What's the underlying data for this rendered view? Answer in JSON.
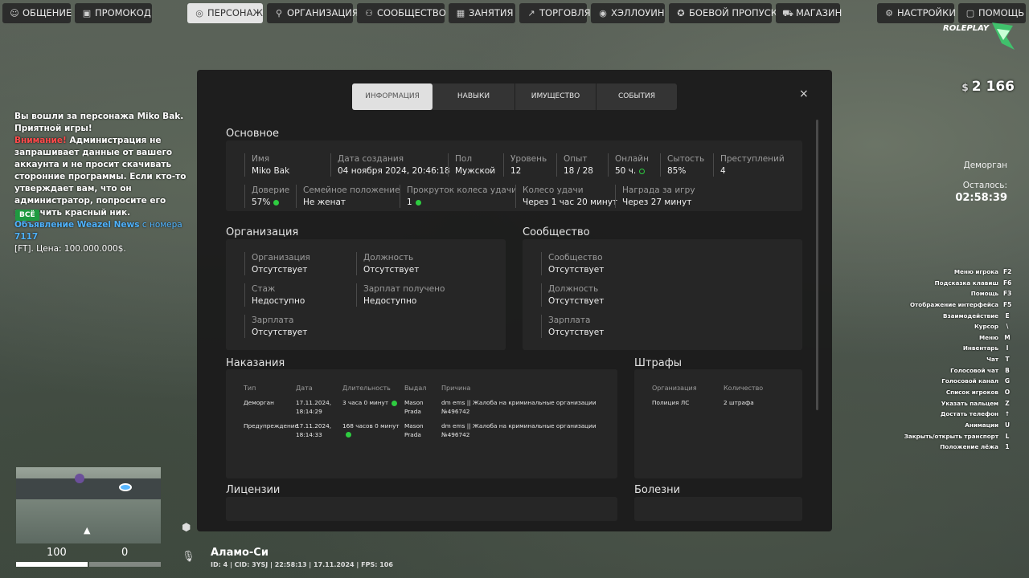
{
  "nav": [
    {
      "label": "ОБЩЕНИЕ",
      "icon": "chat-bubble-icon"
    },
    {
      "label": "ПРОМОКОД",
      "icon": "ticket-icon"
    },
    {
      "label": "ПЕРСОНАЖ",
      "icon": "person-icon",
      "active": true
    },
    {
      "label": "ОРГАНИЗАЦИЯ",
      "icon": "organization-icon"
    },
    {
      "label": "СООБЩЕСТВО",
      "icon": "community-icon"
    },
    {
      "label": "ЗАНЯТИЯ",
      "icon": "calendar-icon"
    },
    {
      "label": "ТОРГОВЛЯ",
      "icon": "trade-chart-icon"
    },
    {
      "label": "ХЭЛЛОУИН",
      "icon": "pumpkin-icon"
    },
    {
      "label": "БОЕВОЙ ПРОПУСК",
      "icon": "battlepass-icon"
    },
    {
      "label": "МАГАЗИН",
      "icon": "cart-icon"
    },
    {
      "label": "НАСТРОЙКИ",
      "icon": "settings-icon"
    },
    {
      "label": "ПОМОЩЬ",
      "icon": "help-icon"
    }
  ],
  "chat": {
    "line1": "Вы вошли за персонажа Miko Bak. Приятной игры!",
    "warn_prefix": "Внимание!",
    "warn_text": " Администрация не запрашивает данные от вашего аккаунта и не просит скачивать сторонние программы. Если кто-то утверждает вам, что он администратор, попросите его включить красный ник.",
    "news_prefix": "Объявление Weazel News",
    "news_from": " с номера ",
    "news_number": "7117",
    "news_text": "[FT]. Цена: 100.000.000$.",
    "all_button": "ВСЁ"
  },
  "hud": {
    "currency": "$",
    "money": "2 166",
    "logo_text": "ROLEPLAY",
    "status": "Деморган",
    "remain_label": "Осталось:",
    "remain_value": "02:58:39",
    "health": "100",
    "armor": "0",
    "location": "Аламо-Си",
    "id_line": "ID: 4 | CID: 3YSJ | 22:58:13 | 17.11.2024 | FPS: 106",
    "accent_color": "#2ecc40"
  },
  "hotkeys": [
    {
      "label": "Меню игрока",
      "key": "F2"
    },
    {
      "label": "Подсказка клавиш",
      "key": "F6"
    },
    {
      "label": "Помощь",
      "key": "F3"
    },
    {
      "label": "Отображение интерфейса",
      "key": "F5"
    },
    {
      "label": "Взаимодействие",
      "key": "E"
    },
    {
      "label": "Курсор",
      "key": "\\"
    },
    {
      "label": "Меню",
      "key": "M"
    },
    {
      "label": "Инвентарь",
      "key": "I"
    },
    {
      "label": "Чат",
      "key": "T"
    },
    {
      "label": "Голосовой чат",
      "key": "B"
    },
    {
      "label": "Голосовой канал",
      "key": "G"
    },
    {
      "label": "Список игроков",
      "key": "O"
    },
    {
      "label": "Указать пальцем",
      "key": "Z"
    },
    {
      "label": "Достать телефон",
      "key": "↑"
    },
    {
      "label": "Анимации",
      "key": "U"
    },
    {
      "label": "Закрыть/открыть транспорт",
      "key": "L"
    },
    {
      "label": "Положение лёжа",
      "key": "1"
    }
  ],
  "modal": {
    "tabs": [
      "ИНФОРМАЦИЯ",
      "НАВЫКИ",
      "ИМУЩЕСТВО",
      "СОБЫТИЯ"
    ],
    "close": "×",
    "basic": {
      "title": "Основное",
      "row1": [
        {
          "label": "Имя",
          "value": "Miko Bak"
        },
        {
          "label": "Дата создания",
          "value": "04 ноября 2024, 20:46:18"
        },
        {
          "label": "Пол",
          "value": "Мужской"
        },
        {
          "label": "Уровень",
          "value": "12"
        },
        {
          "label": "Опыт",
          "value": "18 / 28"
        },
        {
          "label": "Онлайн",
          "value": "50 ч."
        },
        {
          "label": "Сытость",
          "value": "85%"
        },
        {
          "label": "Преступлений",
          "value": "4"
        }
      ],
      "row2": [
        {
          "label": "Доверие",
          "value": "57%"
        },
        {
          "label": "Семейное положение",
          "value": "Не женат"
        },
        {
          "label": "Прокруток колеса удачи",
          "value": "1"
        },
        {
          "label": "Колесо удачи",
          "value": "Через 1 час 20 минут"
        },
        {
          "label": "Награда за игру",
          "value": "Через 27 минут"
        }
      ]
    },
    "org": {
      "title": "Организация",
      "fields": [
        {
          "label": "Организация",
          "value": "Отсутствует"
        },
        {
          "label": "Должность",
          "value": "Отсутствует"
        },
        {
          "label": "Стаж",
          "value": "Недоступно"
        },
        {
          "label": "Зарплат получено",
          "value": "Недоступно"
        },
        {
          "label": "Зарплата",
          "value": "Отсутствует"
        }
      ]
    },
    "community": {
      "title": "Сообщество",
      "fields": [
        {
          "label": "Сообщество",
          "value": "Отсутствует"
        },
        {
          "label": "Должность",
          "value": "Отсутствует"
        },
        {
          "label": "Зарплата",
          "value": "Отсутствует"
        }
      ]
    },
    "punishments": {
      "title": "Наказания",
      "headers": [
        "Тип",
        "Дата",
        "Длительность",
        "Выдал",
        "Причина"
      ],
      "rows": [
        {
          "type": "Деморган",
          "date": "17.11.2024, 18:14:29",
          "duration": "3 часа 0 минут",
          "by": "Mason Prada",
          "reason": "dm ems || Жалоба на криминальные организации №496742"
        },
        {
          "type": "Предупреждение",
          "date": "17.11.2024, 18:14:33",
          "duration": "168 часов 0 минут",
          "by": "Mason Prada",
          "reason": "dm ems || Жалоба на криминальные организации №496742"
        }
      ]
    },
    "fines": {
      "title": "Штрафы",
      "headers": [
        "Организация",
        "Количество"
      ],
      "rows": [
        {
          "org": "Полиция ЛС",
          "count": "2 штрафа"
        }
      ]
    },
    "licenses": {
      "title": "Лицензии"
    },
    "diseases": {
      "title": "Болезни"
    }
  }
}
